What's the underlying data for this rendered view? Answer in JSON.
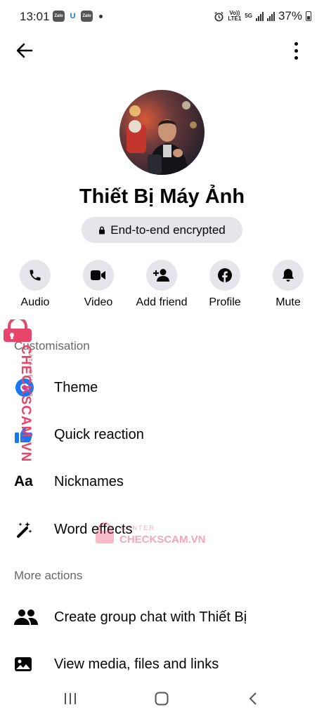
{
  "status_bar": {
    "time": "13:01",
    "app_icons": [
      "Zalo",
      "U",
      "Zalo"
    ],
    "volte_top": "Vo))",
    "volte_bottom": "LTE1",
    "network": "5G",
    "battery": "37%"
  },
  "profile": {
    "name": "Thiết Bị Máy Ảnh",
    "encryption_label": "End-to-end encrypted"
  },
  "actions": [
    {
      "label": "Audio",
      "icon": "phone-icon"
    },
    {
      "label": "Video",
      "icon": "video-camera-icon"
    },
    {
      "label": "Add friend",
      "icon": "add-person-icon"
    },
    {
      "label": "Profile",
      "icon": "facebook-icon"
    },
    {
      "label": "Mute",
      "icon": "bell-icon"
    }
  ],
  "customisation": {
    "title": "Customisation",
    "items": [
      {
        "label": "Theme",
        "icon": "theme-icon"
      },
      {
        "label": "Quick reaction",
        "icon": "thumbs-up-icon"
      },
      {
        "label": "Nicknames",
        "icon": "aa-text-icon",
        "glyph": "Aa"
      },
      {
        "label": "Word effects",
        "icon": "magic-wand-icon"
      }
    ]
  },
  "more_actions": {
    "title": "More actions",
    "items": [
      {
        "label": "Create group chat with Thiết Bị",
        "icon": "group-icon"
      },
      {
        "label": "View media, files and links",
        "icon": "image-icon"
      }
    ]
  },
  "watermark": {
    "side_text": "CHECKSCAM.VN",
    "side_sub": "DATA CENTER",
    "center_top": "CENTER",
    "center_text": "CHECKSCAM.VN"
  },
  "colors": {
    "accent": "#1877f2",
    "pill_bg": "#e4e6eb",
    "secondary_text": "#65676b",
    "watermark": "#e8456b"
  }
}
